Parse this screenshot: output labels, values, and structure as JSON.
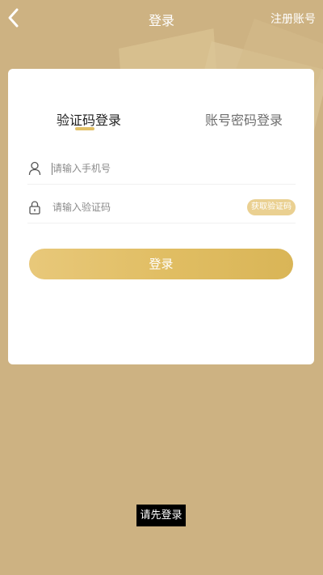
{
  "topbar": {
    "title": "登录",
    "register_label": "注册账号",
    "back_icon": "chevron-left-icon"
  },
  "login_card": {
    "tabs": [
      {
        "label": "验证码登录",
        "active": true
      },
      {
        "label": "账号密码登录",
        "active": false
      }
    ],
    "phone_field": {
      "placeholder": "请输入手机号",
      "value": "",
      "icon": "user-icon"
    },
    "code_field": {
      "placeholder": "请输入验证码",
      "value": "",
      "icon": "lock-icon",
      "get_code_label": "获取验证码"
    },
    "login_button_label": "登录"
  },
  "toast": {
    "message": "请先登录"
  },
  "colors": {
    "background": "#cdb282",
    "accent": "#e2c065",
    "button_gradient_start": "#e8c87a",
    "button_gradient_end": "#d9b557"
  }
}
